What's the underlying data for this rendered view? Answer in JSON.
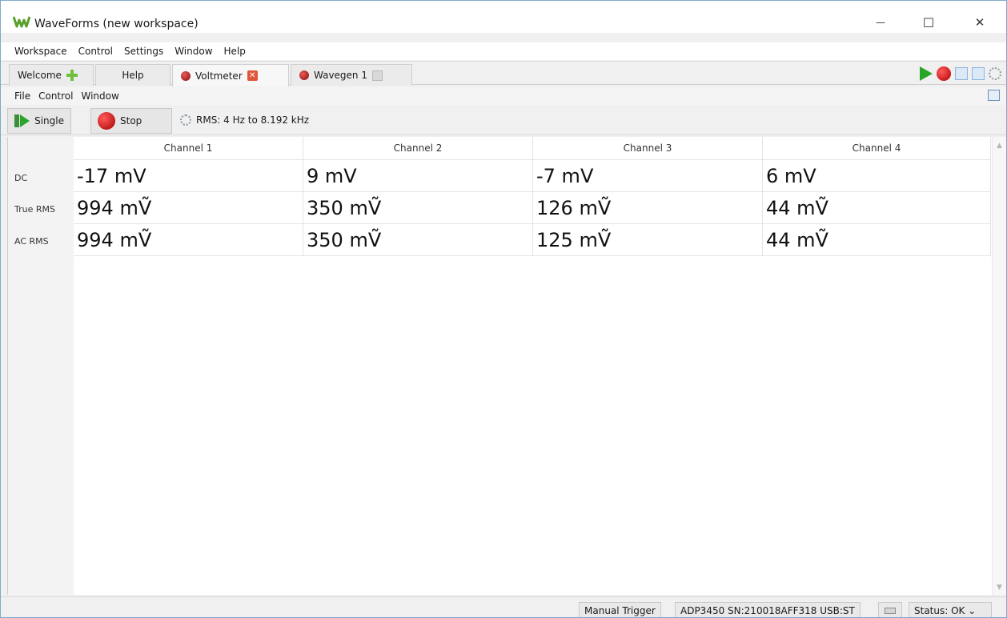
{
  "window": {
    "title": "WaveForms (new workspace)",
    "minimize_glyph": "—",
    "maximize_glyph": "☐",
    "close_glyph": "✕"
  },
  "main_menu": {
    "items": [
      {
        "label": "Workspace"
      },
      {
        "label": "Control"
      },
      {
        "label": "Settings"
      },
      {
        "label": "Window"
      },
      {
        "label": "Help"
      }
    ]
  },
  "tabs": {
    "welcome": "Welcome",
    "help": "Help",
    "voltmeter": "Voltmeter",
    "wavegen": "Wavegen 1",
    "close_glyph": "✕"
  },
  "sub_menu": {
    "items": [
      {
        "label": "File"
      },
      {
        "label": "Control"
      },
      {
        "label": "Window"
      }
    ]
  },
  "toolbar": {
    "single_label": "Single",
    "stop_label": "Stop",
    "rms_info": "RMS: 4 Hz to 8.192 kHz"
  },
  "voltmeter": {
    "columns": [
      "Channel 1",
      "Channel 2",
      "Channel 3",
      "Channel 4"
    ],
    "rows": [
      {
        "label": "DC",
        "values": [
          "-17 mV",
          "9 mV",
          "-7 mV",
          "6 mV"
        ]
      },
      {
        "label": "True RMS",
        "values": [
          "994 mṼ",
          "350 mṼ",
          "126 mṼ",
          "44 mṼ"
        ]
      },
      {
        "label": "AC RMS",
        "values": [
          "994 mṼ",
          "350 mṼ",
          "125 mṼ",
          "44 mṼ"
        ]
      }
    ]
  },
  "statusbar": {
    "trigger": "Manual Trigger",
    "device": "ADP3450 SN:210018AFF318 USB:ST",
    "status": "Status: OK ⌄"
  },
  "icons": {
    "app_logo_color": "#5aa02c",
    "run_color": "#2aa52a",
    "record_color": "#c00000"
  }
}
